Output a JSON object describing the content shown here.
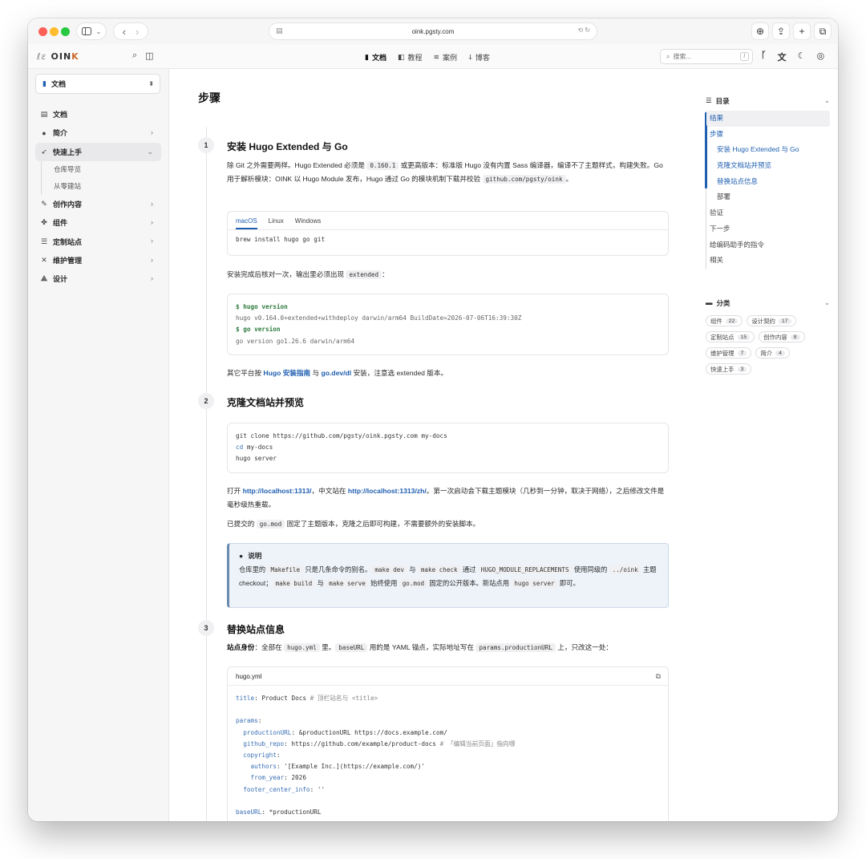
{
  "browser": {
    "url": "oink.pgsty.com",
    "nav_back": "‹",
    "nav_forward": "›",
    "url_left_icon": "page-icon",
    "url_right_icons": "translate-reload"
  },
  "header": {
    "logo_mark": "ℓε",
    "logo_text_a": "OIN",
    "logo_text_b": "K",
    "nav": [
      {
        "label": "文档",
        "icon": "book-icon",
        "active": true
      },
      {
        "label": "教程",
        "icon": "panel-icon",
        "active": false
      },
      {
        "label": "案例",
        "icon": "layers-icon",
        "active": false
      },
      {
        "label": "博客",
        "icon": "rss-icon",
        "active": false
      }
    ],
    "search_placeholder": "搜索...",
    "search_shortcut": "/"
  },
  "sidebar": {
    "section": "文档",
    "items": [
      {
        "label": "文档",
        "icon": "book-icon",
        "arrow": ""
      },
      {
        "label": "简介",
        "icon": "info-icon",
        "arrow": "›"
      },
      {
        "label": "快速上手",
        "icon": "rocket-icon",
        "arrow": "⌄"
      },
      {
        "label": "创作内容",
        "icon": "pen-icon",
        "arrow": "›"
      },
      {
        "label": "组件",
        "icon": "puzzle-icon",
        "arrow": "›"
      },
      {
        "label": "定制站点",
        "icon": "sliders-icon",
        "arrow": "›"
      },
      {
        "label": "维护管理",
        "icon": "tools-icon",
        "arrow": "›"
      },
      {
        "label": "设计",
        "icon": "design-icon",
        "arrow": "›"
      }
    ],
    "subitems": [
      "仓库导览",
      "从零建站"
    ]
  },
  "main": {
    "title": "步骤",
    "step1": {
      "num": "1",
      "title": "安装 Hugo Extended 与 Go",
      "p1_a": "除 Git 之外需要两样。Hugo Extended 必须是 ",
      "p1_code1": "0.160.1",
      "p1_b": " 或更高版本：标准版 Hugo 没有内置 Sass 编译器，编译不了主题样式，构建失败。Go 用于解析模块：OINK 以 Hugo Module 发布，Hugo 通过 Go 的模块机制下载并校验 ",
      "p1_code2": "github.com/pgsty/oink",
      "p1_c": "。",
      "tabs": [
        "macOS",
        "Linux",
        "Windows"
      ],
      "install_cmd": "brew install hugo go git",
      "p2_a": "安装完成后核对一次，输出里必须出现 ",
      "p2_code": "extended",
      "p2_b": "：",
      "ver_cmd1": "$ hugo version",
      "ver_out1": "hugo v0.164.0+extended+withdeploy darwin/arm64 BuildDate=2026-07-06T16:39:30Z",
      "ver_cmd2": "$ go version",
      "ver_out2": "go version go1.26.6 darwin/arm64",
      "p3_a": "其它平台按 ",
      "p3_link1": "Hugo 安装指南",
      "p3_b": " 与 ",
      "p3_link2": "go.dev/dl",
      "p3_c": " 安装，注意选 extended 版本。"
    },
    "step2": {
      "num": "2",
      "title": "克隆文档站并预览",
      "code1": "git clone https://github.com/pgsty/oink.pgsty.com my-docs",
      "code2_kw": "cd",
      "code2_rest": " my-docs",
      "code3": "hugo server",
      "p1_a": "打开 ",
      "p1_link1": "http://localhost:1313/",
      "p1_b": "，中文站在 ",
      "p1_link2": "http://localhost:1313/zh/",
      "p1_c": "。第一次启动会下载主题模块（几秒到一分钟，取决于网络），之后修改文件是毫秒级热重载。",
      "p2_a": "已提交的 ",
      "p2_code": "go.mod",
      "p2_b": " 固定了主题版本，克隆之后即可构建，不需要额外的安装脚本。"
    },
    "note": {
      "title": "说明",
      "t1": "仓库里的 ",
      "c1": "Makefile",
      "t2": " 只是几条命令的别名。",
      "c2": "make dev",
      "t3": " 与 ",
      "c3": "make check",
      "t4": " 通过 ",
      "c4": "HUGO_MODULE_REPLACEMENTS",
      "t5": " 使用同级的 ",
      "c5": "../oink",
      "t6": " 主题 checkout；",
      "c6": "make build",
      "t7": " 与 ",
      "c7": "make serve",
      "t8": " 始终使用 ",
      "c8": "go.mod",
      "t9": " 固定的公开版本。新站点用 ",
      "c9": "hugo server",
      "t10": " 即可。"
    },
    "step3": {
      "num": "3",
      "title": "替换站点信息",
      "p_b": "站点身份",
      "p_a": "：全部在 ",
      "p_code1": "hugo.yml",
      "p_c": " 里。",
      "p_code2": "baseURL",
      "p_d": " 用的是 YAML 锚点，实际地址写在 ",
      "p_code3": "params.productionURL",
      "p_e": " 上，只改这一处：",
      "file": "hugo.yml",
      "yaml": {
        "l1_k": "title",
        "l1_v": ": Product Docs ",
        "l1_c": "# 顶栏站名与 <title>",
        "l2_k": "params",
        "l3_k": "  productionURL",
        "l3_v": ": &productionURL https://docs.example.com/",
        "l4_k": "  github_repo",
        "l4_v": ": https://github.com/example/product-docs ",
        "l4_c": "# 「编辑当前页面」指向哪",
        "l5_k": "  copyright",
        "l6_k": "    authors",
        "l6_v": ": '[Example Inc.](https://example.com/)'",
        "l7_k": "    from_year",
        "l7_v": ": 2026",
        "l8_k": "  footer_center_info",
        "l8_v": ": ''",
        "l9_k": "baseURL",
        "l9_v": ": *productionURL"
      }
    }
  },
  "toc": {
    "title": "目录",
    "items": [
      {
        "label": "结果",
        "sub": false
      },
      {
        "label": "步骤",
        "sub": false
      },
      {
        "label": "安装 Hugo Extended 与 Go",
        "sub": true
      },
      {
        "label": "克隆文档站并预览",
        "sub": true
      },
      {
        "label": "替换站点信息",
        "sub": true
      },
      {
        "label": "部署",
        "sub": true
      },
      {
        "label": "验证",
        "sub": false
      },
      {
        "label": "下一步",
        "sub": false
      },
      {
        "label": "给编码助手的指令",
        "sub": false
      },
      {
        "label": "相关",
        "sub": false
      }
    ],
    "cat_title": "分类",
    "tags": [
      {
        "label": "组件",
        "count": "22"
      },
      {
        "label": "设计契约",
        "count": "17"
      },
      {
        "label": "定制站点",
        "count": "15"
      },
      {
        "label": "创作内容",
        "count": "8"
      },
      {
        "label": "维护管理",
        "count": "7"
      },
      {
        "label": "简介",
        "count": "4"
      },
      {
        "label": "快速上手",
        "count": "3"
      }
    ]
  }
}
